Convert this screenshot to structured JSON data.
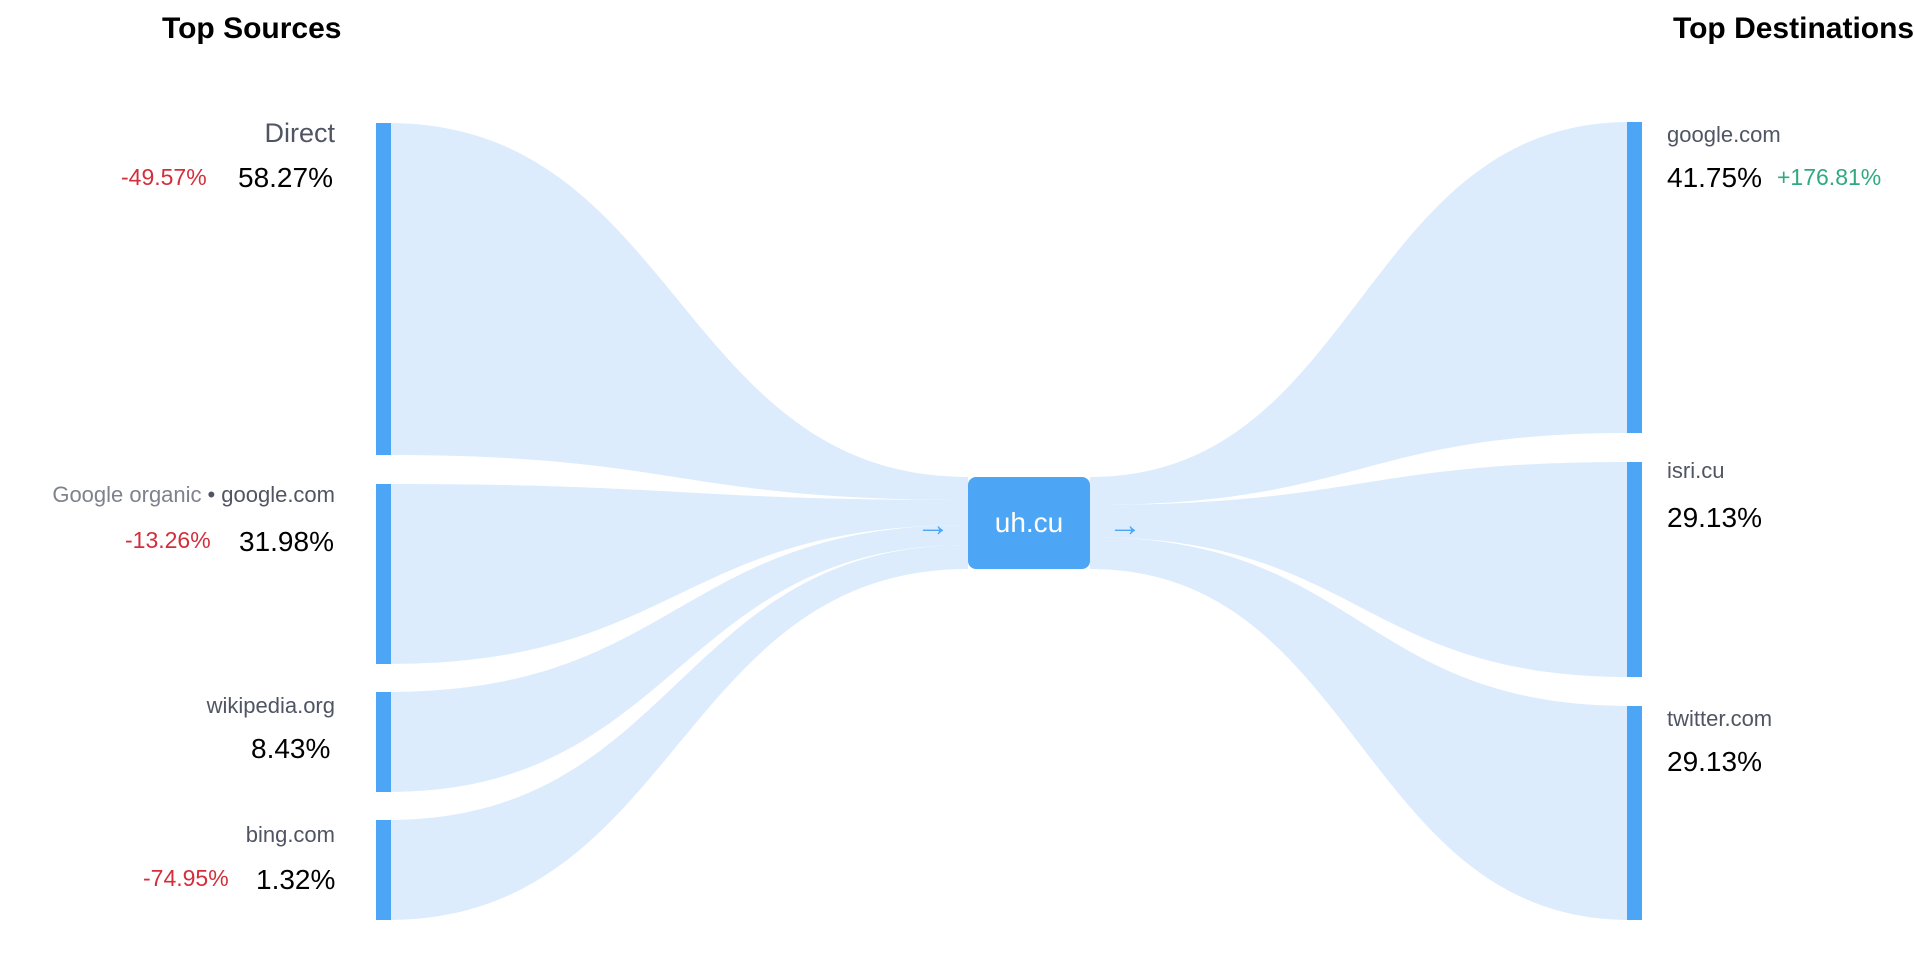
{
  "headings": {
    "sources": "Top Sources",
    "destinations": "Top Destinations"
  },
  "center": {
    "label": "uh.cu"
  },
  "colors": {
    "accent": "#4da6f5",
    "flow": "#dcecfd",
    "negative": "#d32f3b",
    "positive": "#2faa7e"
  },
  "sources": [
    {
      "name": "Direct",
      "share": "58.27%",
      "change": "-49.57%"
    },
    {
      "name_secondary": "Google organic",
      "separator": "•",
      "name": "google.com",
      "share": "31.98%",
      "change": "-13.26%"
    },
    {
      "name": "wikipedia.org",
      "share": "8.43%"
    },
    {
      "name": "bing.com",
      "share": "1.32%",
      "change": "-74.95%"
    }
  ],
  "destinations": [
    {
      "name": "google.com",
      "share": "41.75%",
      "change": "+176.81%"
    },
    {
      "name": "isri.cu",
      "share": "29.13%"
    },
    {
      "name": "twitter.com",
      "share": "29.13%"
    }
  ]
}
